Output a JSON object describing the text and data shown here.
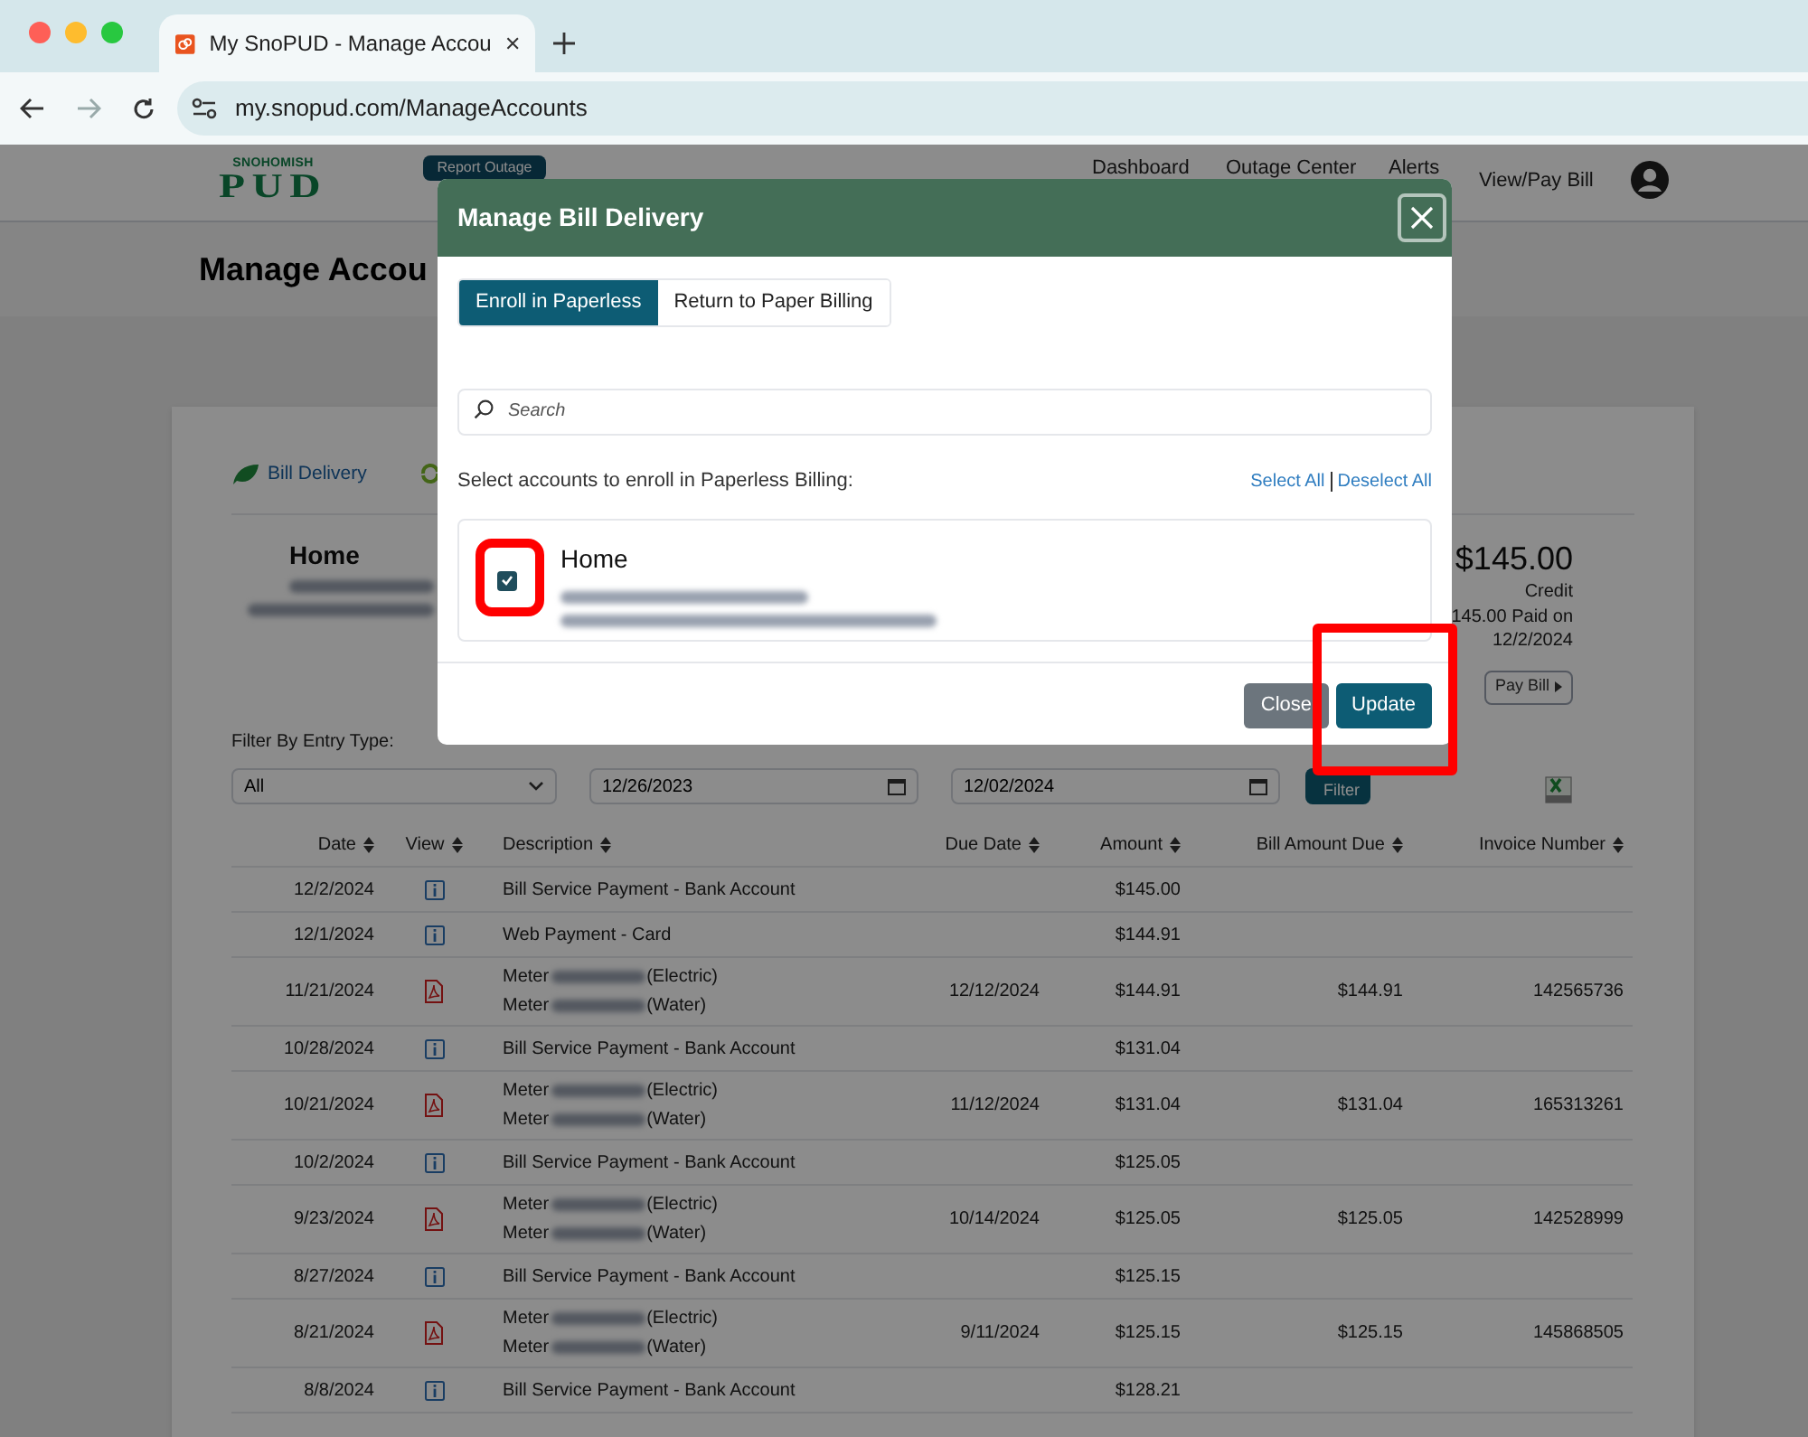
{
  "browser": {
    "tab_title": "My SnoPUD - Manage Accou",
    "url": "my.snopud.com/ManageAccounts"
  },
  "header": {
    "logo_top": "SNOHOMISH",
    "logo_main": "PUD",
    "report_button": "Report Outage",
    "nav": [
      "Dashboard",
      "Outage Center",
      "Alerts",
      "View/Pay Bill"
    ]
  },
  "page_title": "Manage Accou",
  "delivery_tab": "Bill Delivery",
  "summary": {
    "name": "Home",
    "balance": "$145.00",
    "balance_label": "Credit",
    "paid_line": "145.00 Paid on",
    "paid_date": "12/2/2024",
    "pay_button": "Pay Bill"
  },
  "filter": {
    "label": "Filter By Entry Type:",
    "type_value": "All",
    "from_value": "12/26/2023",
    "to_value": "12/02/2024",
    "button": "Filter"
  },
  "table": {
    "columns": [
      "Date",
      "View",
      "Description",
      "Due Date",
      "Amount",
      "Bill Amount Due",
      "Invoice Number"
    ],
    "rows": [
      {
        "date": "12/2/2024",
        "kind": "info",
        "description": "Bill Service Payment - Bank Account",
        "amount": "$145.00"
      },
      {
        "date": "12/1/2024",
        "kind": "info",
        "description": "Web Payment - Card",
        "amount": "$144.91"
      },
      {
        "date": "11/21/2024",
        "kind": "pdf",
        "meters": [
          {
            "label": "Meter",
            "service": "(Electric)"
          },
          {
            "label": "Meter",
            "service": "(Water)"
          }
        ],
        "due_date": "12/12/2024",
        "amount": "$144.91",
        "bill_amount_due": "$144.91",
        "invoice_number": "142565736"
      },
      {
        "date": "10/28/2024",
        "kind": "info",
        "description": "Bill Service Payment - Bank Account",
        "amount": "$131.04"
      },
      {
        "date": "10/21/2024",
        "kind": "pdf",
        "meters": [
          {
            "label": "Meter",
            "service": "(Electric)"
          },
          {
            "label": "Meter",
            "service": "(Water)"
          }
        ],
        "due_date": "11/12/2024",
        "amount": "$131.04",
        "bill_amount_due": "$131.04",
        "invoice_number": "165313261"
      },
      {
        "date": "10/2/2024",
        "kind": "info",
        "description": "Bill Service Payment - Bank Account",
        "amount": "$125.05"
      },
      {
        "date": "9/23/2024",
        "kind": "pdf",
        "meters": [
          {
            "label": "Meter",
            "service": "(Electric)"
          },
          {
            "label": "Meter",
            "service": "(Water)"
          }
        ],
        "due_date": "10/14/2024",
        "amount": "$125.05",
        "bill_amount_due": "$125.05",
        "invoice_number": "142528999"
      },
      {
        "date": "8/27/2024",
        "kind": "info",
        "description": "Bill Service Payment - Bank Account",
        "amount": "$125.15"
      },
      {
        "date": "8/21/2024",
        "kind": "pdf",
        "meters": [
          {
            "label": "Meter",
            "service": "(Electric)"
          },
          {
            "label": "Meter",
            "service": "(Water)"
          }
        ],
        "due_date": "9/11/2024",
        "amount": "$125.15",
        "bill_amount_due": "$125.15",
        "invoice_number": "145868505"
      },
      {
        "date": "8/8/2024",
        "kind": "info",
        "description": "Bill Service Payment - Bank Account",
        "amount": "$128.21"
      }
    ]
  },
  "modal": {
    "title": "Manage Bill Delivery",
    "tabs": [
      {
        "label": "Enroll in Paperless",
        "selected": true
      },
      {
        "label": "Return to Paper Billing",
        "selected": false
      }
    ],
    "search_placeholder": "Search",
    "prompt": "Select accounts to enroll in Paperless Billing:",
    "select_all": "Select All",
    "deselect_all": "Deselect All",
    "accounts": [
      {
        "name": "Home",
        "checked": true
      }
    ],
    "close_button": "Close",
    "update_button": "Update"
  }
}
